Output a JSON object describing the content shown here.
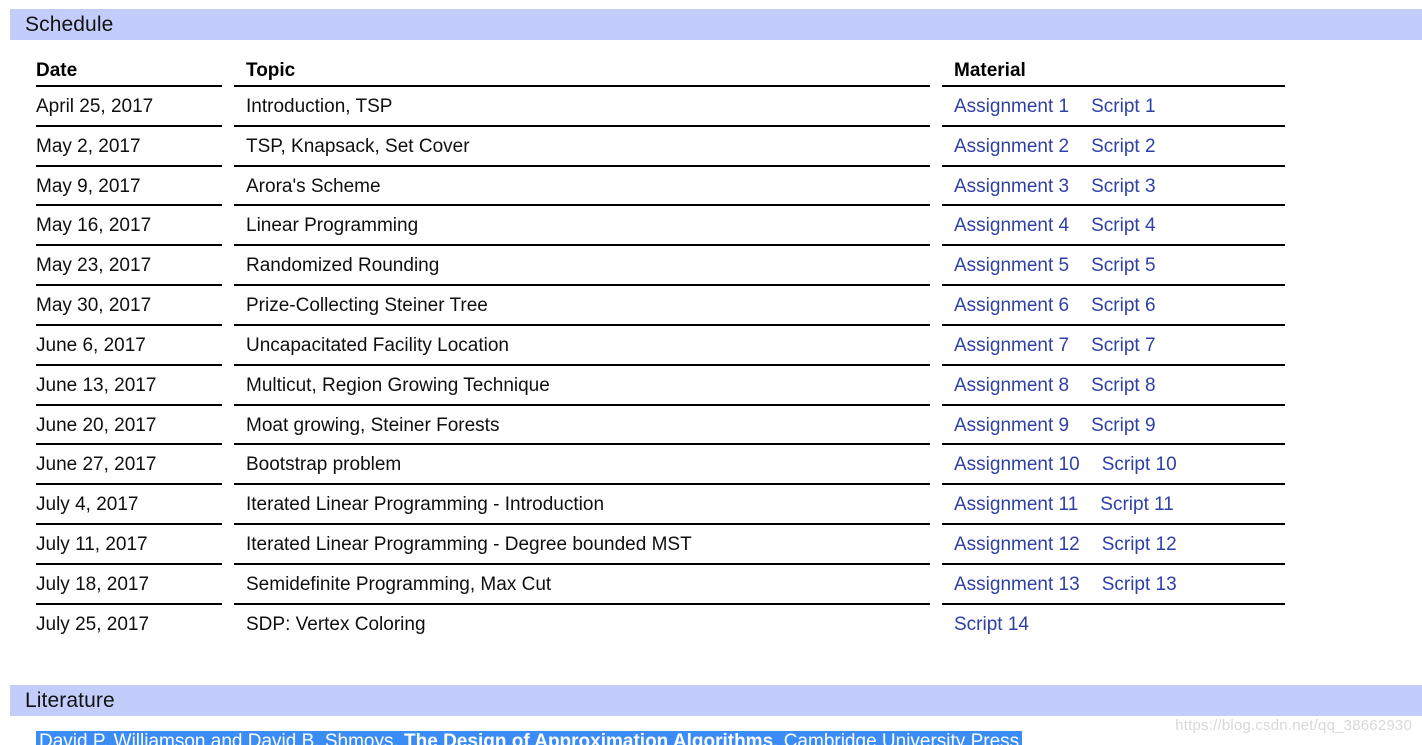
{
  "sections": {
    "schedule": {
      "title": "Schedule",
      "band_color": "#c2cdfb"
    },
    "literature": {
      "title": "Literature",
      "band_color": "#c2cdfb"
    }
  },
  "schedule_table": {
    "columns": [
      "Date",
      "Topic",
      "Material"
    ],
    "rows": [
      {
        "date": "April 25, 2017",
        "topic": "Introduction, TSP",
        "material": [
          "Assignment 1",
          "Script 1"
        ]
      },
      {
        "date": "May 2, 2017",
        "topic": "TSP, Knapsack, Set Cover",
        "material": [
          "Assignment 2",
          "Script 2"
        ]
      },
      {
        "date": "May 9, 2017",
        "topic": "Arora's Scheme",
        "material": [
          "Assignment 3",
          "Script 3"
        ]
      },
      {
        "date": "May 16, 2017",
        "topic": "Linear Programming",
        "material": [
          "Assignment 4",
          "Script 4"
        ]
      },
      {
        "date": "May 23, 2017",
        "topic": "Randomized Rounding",
        "material": [
          "Assignment 5",
          "Script 5"
        ]
      },
      {
        "date": "May 30, 2017",
        "topic": "Prize-Collecting Steiner Tree",
        "material": [
          "Assignment 6",
          "Script 6"
        ]
      },
      {
        "date": "June 6, 2017",
        "topic": "Uncapacitated Facility Location",
        "material": [
          "Assignment 7",
          "Script 7"
        ]
      },
      {
        "date": "June 13, 2017",
        "topic": "Multicut, Region Growing Technique",
        "material": [
          "Assignment 8",
          "Script 8"
        ]
      },
      {
        "date": "June 20, 2017",
        "topic": "Moat growing, Steiner Forests",
        "material": [
          "Assignment 9",
          "Script 9"
        ]
      },
      {
        "date": "June 27, 2017",
        "topic": "Bootstrap problem",
        "material": [
          "Assignment 10",
          "Script 10"
        ]
      },
      {
        "date": "July 4, 2017",
        "topic": "Iterated Linear Programming - Introduction",
        "material": [
          "Assignment 11",
          "Script 11"
        ]
      },
      {
        "date": "July 11, 2017",
        "topic": "Iterated Linear Programming - Degree bounded MST",
        "material": [
          "Assignment 12",
          "Script 12"
        ]
      },
      {
        "date": "July 18, 2017",
        "topic": "Semidefinite Programming, Max Cut",
        "material": [
          "Assignment 13",
          "Script 13"
        ]
      },
      {
        "date": "July 25, 2017",
        "topic": "SDP: Vertex Coloring",
        "material": [
          "Script 14"
        ]
      }
    ]
  },
  "literature": {
    "entries": [
      {
        "authors": "David P. Williamson and David B. Shmoys,",
        "work": "The Design of Approximation Algorithms",
        "publisher": ", Cambridge University Press",
        "selected": true,
        "selection_color": "#3b8cf7"
      }
    ]
  },
  "watermark": {
    "text": "https://blog.csdn.net/qq_38662930"
  },
  "colors": {
    "band": "#c2cdfb",
    "link": "#2e3fa6",
    "rule": "#000000",
    "selection": "#3b8cf7",
    "text": "#0f0f0f"
  }
}
